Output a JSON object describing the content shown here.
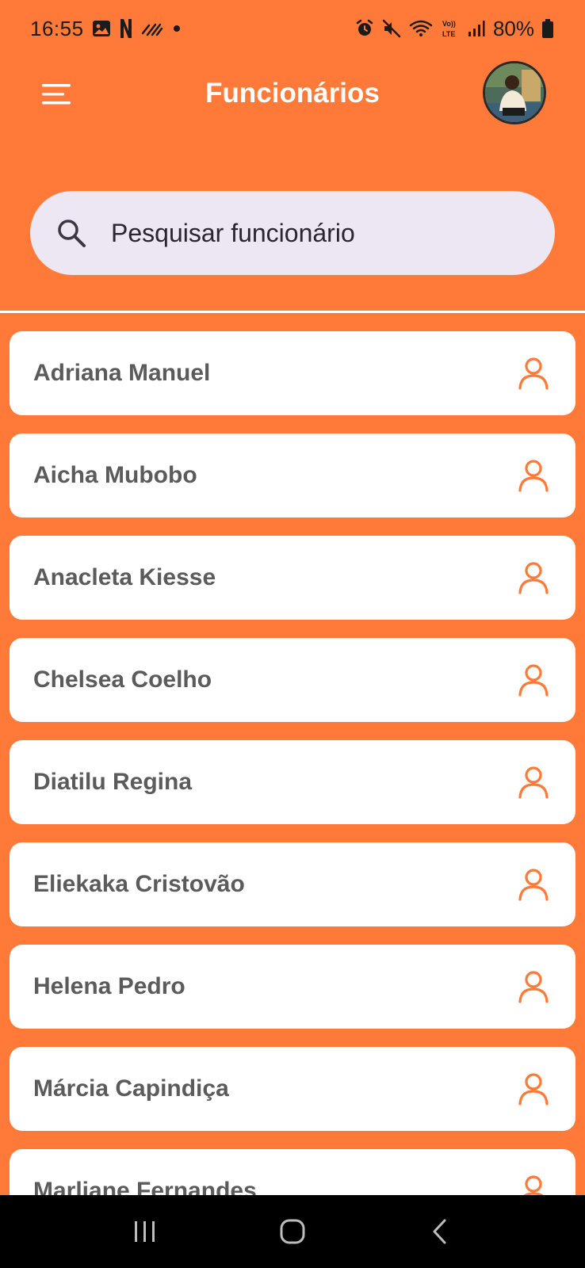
{
  "status_bar": {
    "time": "16:55",
    "battery": "80%",
    "left_icons": [
      "gallery-icon",
      "netflix-icon",
      "signal-wave-icon",
      "dot-icon"
    ],
    "right_icons": [
      "alarm-icon",
      "mute-icon",
      "wifi-icon",
      "volte-icon",
      "cell-signal-icon",
      "battery-icon"
    ]
  },
  "app_bar": {
    "title": "Funcionários",
    "menu_icon": "menu-icon",
    "avatar": "user-avatar"
  },
  "search": {
    "placeholder": "Pesquisar funcionário",
    "value": "",
    "icon": "search-icon"
  },
  "employees": [
    {
      "name": "Adriana Manuel"
    },
    {
      "name": "Aicha Mubobo"
    },
    {
      "name": "Anacleta Kiesse"
    },
    {
      "name": "Chelsea Coelho"
    },
    {
      "name": "Diatilu Regina"
    },
    {
      "name": "Eliekaka Cristovão"
    },
    {
      "name": "Helena Pedro"
    },
    {
      "name": "Márcia Capindiça"
    },
    {
      "name": "Marliane Fernandes"
    }
  ],
  "nav_bar": {
    "buttons": [
      "recents-icon",
      "home-icon",
      "back-icon"
    ]
  },
  "colors": {
    "primary": "#FF7A38",
    "card": "#FFFFFF",
    "search_bg": "#EDE6F3",
    "text": "#5B5B5B",
    "icon_accent": "#FF7A38"
  }
}
